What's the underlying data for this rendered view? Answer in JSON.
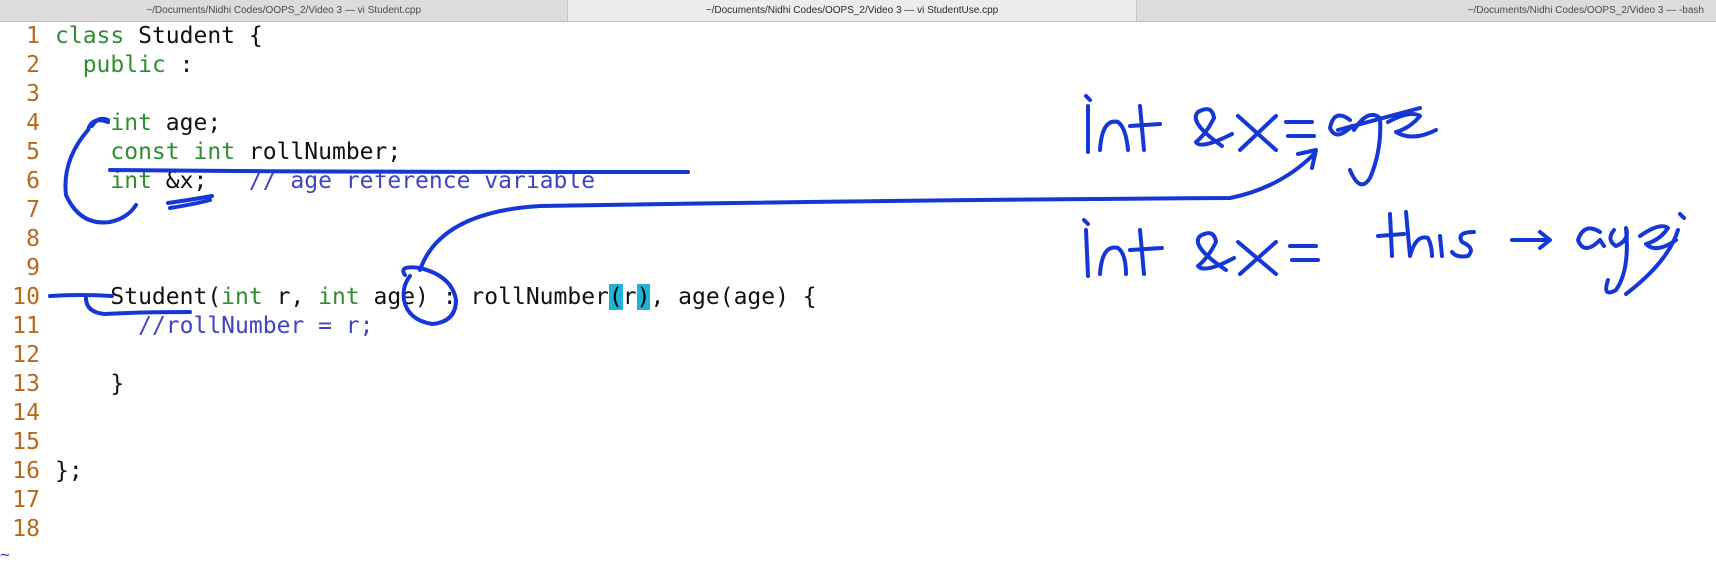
{
  "tabs": [
    {
      "label": "~/Documents/Nidhi Codes/OOPS_2/Video 3 — vi Student.cpp"
    },
    {
      "label": "~/Documents/Nidhi Codes/OOPS_2/Video 3 — vi StudentUse.cpp"
    },
    {
      "label": "~/Documents/Nidhi Codes/OOPS_2/Video 3 — -bash"
    }
  ],
  "lines": [
    {
      "n": "1",
      "segs": [
        [
          "kw",
          "class"
        ],
        [
          "code",
          " Student {"
        ]
      ]
    },
    {
      "n": "2",
      "segs": [
        [
          "code",
          "  "
        ],
        [
          "kw",
          "public"
        ],
        [
          "code",
          " :"
        ]
      ]
    },
    {
      "n": "3",
      "segs": []
    },
    {
      "n": "4",
      "segs": [
        [
          "code",
          "    "
        ],
        [
          "kw",
          "int"
        ],
        [
          "code",
          " age;"
        ]
      ]
    },
    {
      "n": "5",
      "segs": [
        [
          "code",
          "    "
        ],
        [
          "kw",
          "const"
        ],
        [
          "code",
          " "
        ],
        [
          "kw",
          "int"
        ],
        [
          "code",
          " rollNumber;"
        ]
      ]
    },
    {
      "n": "6",
      "segs": [
        [
          "code",
          "    "
        ],
        [
          "kw",
          "int"
        ],
        [
          "code",
          " &x;   "
        ],
        [
          "cm",
          "// age reference variable"
        ]
      ]
    },
    {
      "n": "7",
      "segs": []
    },
    {
      "n": "8",
      "segs": []
    },
    {
      "n": "9",
      "segs": []
    },
    {
      "n": "10",
      "segs": [
        [
          "code",
          "    Student("
        ],
        [
          "kw",
          "int"
        ],
        [
          "code",
          " r, "
        ],
        [
          "kw",
          "int"
        ],
        [
          "code",
          " age) : rollNumber"
        ],
        [
          "hl",
          "("
        ],
        [
          "code",
          "r"
        ],
        [
          "hl",
          ")"
        ],
        [
          "code",
          ", age(age) {"
        ]
      ]
    },
    {
      "n": "11",
      "segs": [
        [
          "code",
          "      "
        ],
        [
          "cm",
          "//rollNumber = r;"
        ]
      ]
    },
    {
      "n": "12",
      "segs": []
    },
    {
      "n": "13",
      "segs": [
        [
          "code",
          "    }"
        ]
      ]
    },
    {
      "n": "14",
      "segs": []
    },
    {
      "n": "15",
      "segs": []
    },
    {
      "n": "16",
      "segs": [
        [
          "code",
          "};"
        ]
      ]
    },
    {
      "n": "17",
      "segs": []
    },
    {
      "n": "18",
      "segs": []
    }
  ],
  "tilde": "~",
  "annotations": [
    "int &x = age",
    "int &x = this → age;"
  ],
  "colors": {
    "ink": "#1437d6",
    "keyword": "#2f8f2f",
    "comment": "#3f44c4",
    "line_number": "#b86a1c",
    "highlight": "#1fb4d6"
  }
}
